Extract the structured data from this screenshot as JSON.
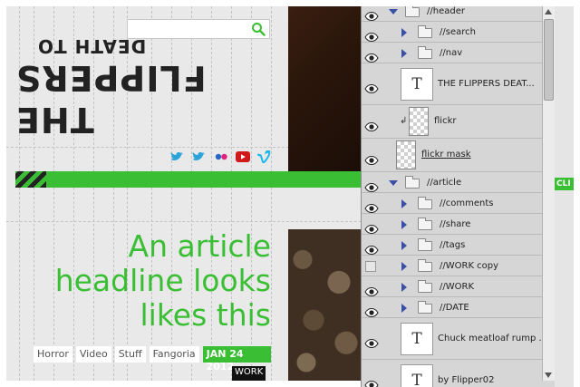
{
  "colors": {
    "accent_green": "#3abf34",
    "panel_bg": "#d6d6d6",
    "canvas_bg": "#e9e9e9"
  },
  "canvas": {
    "search": {
      "placeholder": "",
      "icon": "search-icon"
    },
    "logo": {
      "line1": "DEATH TO",
      "line2": "THE FLIPPERS"
    },
    "social_icons": [
      "twitter-icon",
      "twitter-icon",
      "flickr-icon",
      "youtube-icon",
      "vimeo-icon"
    ],
    "headline": {
      "line1": "An article",
      "line2": "headline looks",
      "line3": "likes this"
    },
    "tags": [
      "Horror",
      "Video",
      "Stuff",
      "Fangoria"
    ],
    "date": "JAN 24 2012",
    "work_label": "WORK",
    "side_badge": "CLI"
  },
  "layers": [
    {
      "name": "//header",
      "kind": "group",
      "expanded": true,
      "visible": true
    },
    {
      "name": "//search",
      "kind": "group",
      "expanded": false,
      "visible": true
    },
    {
      "name": "//nav",
      "kind": "group",
      "expanded": false,
      "visible": true
    },
    {
      "name": "THE FLIPPERS DEAT...",
      "kind": "text",
      "visible": true
    },
    {
      "name": "flickr",
      "kind": "image",
      "visible": true
    },
    {
      "name": "flickr mask",
      "kind": "image",
      "visible": true
    },
    {
      "name": "//article",
      "kind": "group",
      "expanded": true,
      "visible": true
    },
    {
      "name": "//comments",
      "kind": "group",
      "expanded": false,
      "visible": true
    },
    {
      "name": "//share",
      "kind": "group",
      "expanded": false,
      "visible": true
    },
    {
      "name": "//tags",
      "kind": "group",
      "expanded": false,
      "visible": true
    },
    {
      "name": "//WORK copy",
      "kind": "group",
      "expanded": false,
      "visible": false
    },
    {
      "name": "//WORK",
      "kind": "group",
      "expanded": false,
      "visible": true
    },
    {
      "name": "//DATE",
      "kind": "group",
      "expanded": false,
      "visible": true
    },
    {
      "name": "Chuck meatloaf rump ...",
      "kind": "text",
      "visible": true
    },
    {
      "name": "by Flipper02",
      "kind": "text",
      "visible": true
    }
  ]
}
